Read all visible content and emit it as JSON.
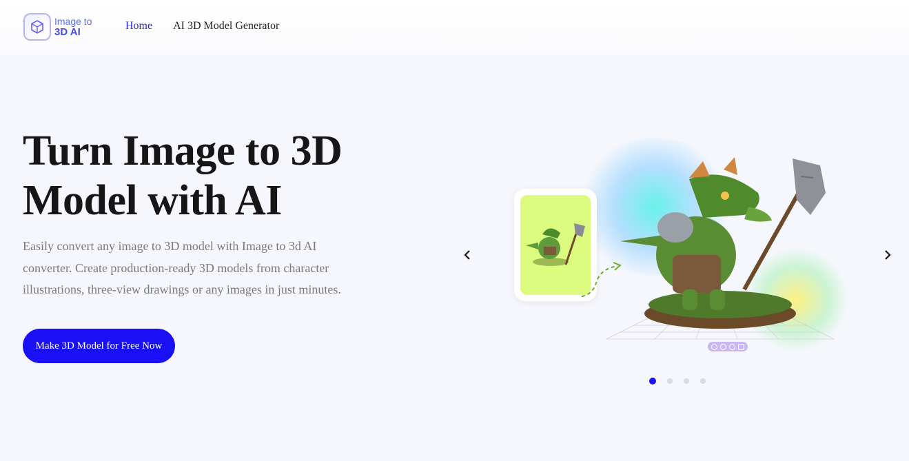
{
  "header": {
    "logo": {
      "line1": "Image to",
      "line2": "3D AI"
    },
    "nav": [
      {
        "label": "Home",
        "active": true
      },
      {
        "label": "AI 3D Model Generator",
        "active": false
      }
    ]
  },
  "hero": {
    "title": "Turn Image to 3D Model with AI",
    "description": "Easily convert any image to 3D model with Image to 3d AI converter. Create production-ready 3D models from character illustrations, three-view drawings or any images in just minutes.",
    "cta_label": "Make 3D Model for Free Now"
  },
  "carousel": {
    "slide_count": 4,
    "active_slide": 1,
    "prev_icon": "chevron-left-icon",
    "next_icon": "chevron-right-icon"
  },
  "colors": {
    "accent": "#1a10f5",
    "nav_active": "#2b24d9",
    "card_bg": "#dcfb7e",
    "page_bg": "#f6f7fd"
  }
}
